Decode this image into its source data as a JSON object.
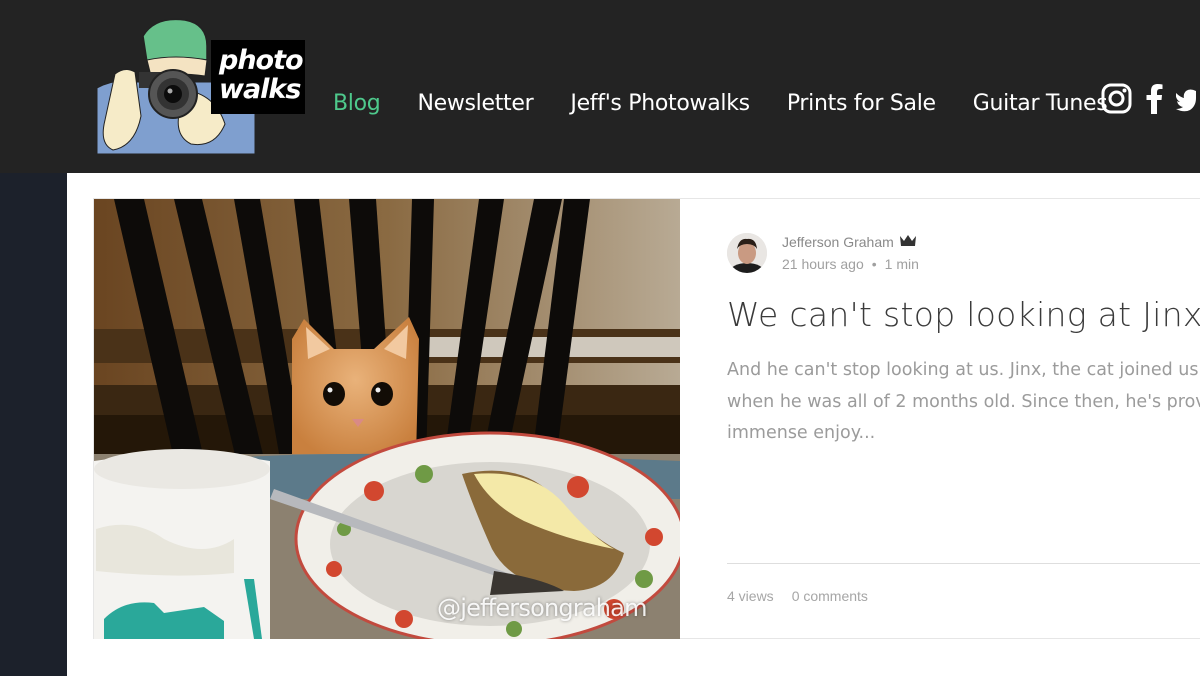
{
  "brand": {
    "logo_text_line1": "photo",
    "logo_text_line2": "walks",
    "colors": {
      "header_bg": "#232323",
      "active_nav": "#4ec98c",
      "sidebar": "#1c212b"
    }
  },
  "nav": {
    "items": [
      {
        "label": "Blog",
        "active": true
      },
      {
        "label": "Newsletter",
        "active": false
      },
      {
        "label": "Jeff's Photowalks",
        "active": false
      },
      {
        "label": "Prints for Sale",
        "active": false
      },
      {
        "label": "Guitar Tunes",
        "active": false
      }
    ]
  },
  "social": [
    "instagram-icon",
    "facebook-icon",
    "twitter-icon"
  ],
  "post": {
    "image_watermark": "@jeffersongraham",
    "author": "Jefferson Graham",
    "author_badge": "crown-icon",
    "time_ago": "21 hours ago",
    "separator": "•",
    "read_time": "1 min",
    "title": "We can't stop looking at Jinx",
    "excerpt": "And he can't stop looking at us. Jinx, the cat joined us in\nwhen he was all of 2 months old. Since then, he's provi\nimmense enjoy...",
    "views": "4 views",
    "comments": "0 comments"
  }
}
